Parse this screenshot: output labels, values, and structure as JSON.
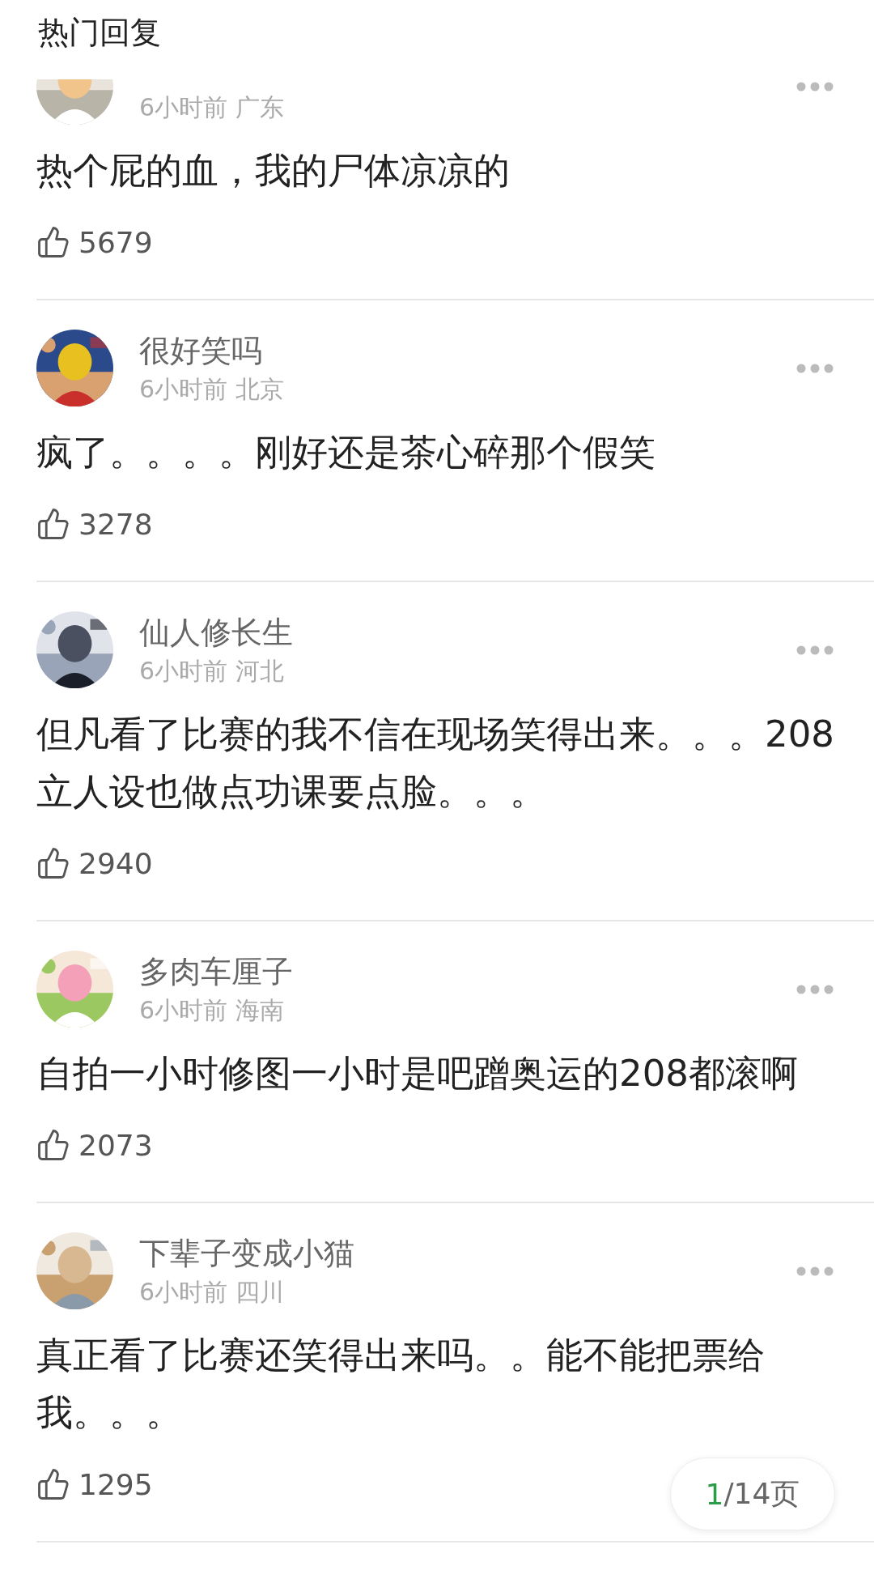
{
  "header": {
    "title": "热门回复"
  },
  "comments": [
    {
      "meta": "6小时前 广东",
      "text": "热个屁的血，我的尸体凉凉的",
      "likes": "5679"
    },
    {
      "name": "很好笑吗",
      "meta": "6小时前 北京",
      "text": "疯了。。。。刚好还是茶心碎那个假笑",
      "likes": "3278"
    },
    {
      "name": "仙人修长生",
      "meta": "6小时前 河北",
      "text": "但凡看了比赛的我不信在现场笑得出来。。。208立人设也做点功课要点脸。。。",
      "likes": "2940"
    },
    {
      "name": "多肉车厘子",
      "meta": "6小时前 海南",
      "text": "自拍一小时修图一小时是吧蹭奥运的208都滚啊",
      "likes": "2073"
    },
    {
      "name": "下辈子变成小猫",
      "meta": "6小时前 四川",
      "text": "真正看了比赛还笑得出来吗。。能不能把票给我。。。",
      "likes": "1295"
    }
  ],
  "pager": {
    "current": "1",
    "rest": "/14页"
  }
}
